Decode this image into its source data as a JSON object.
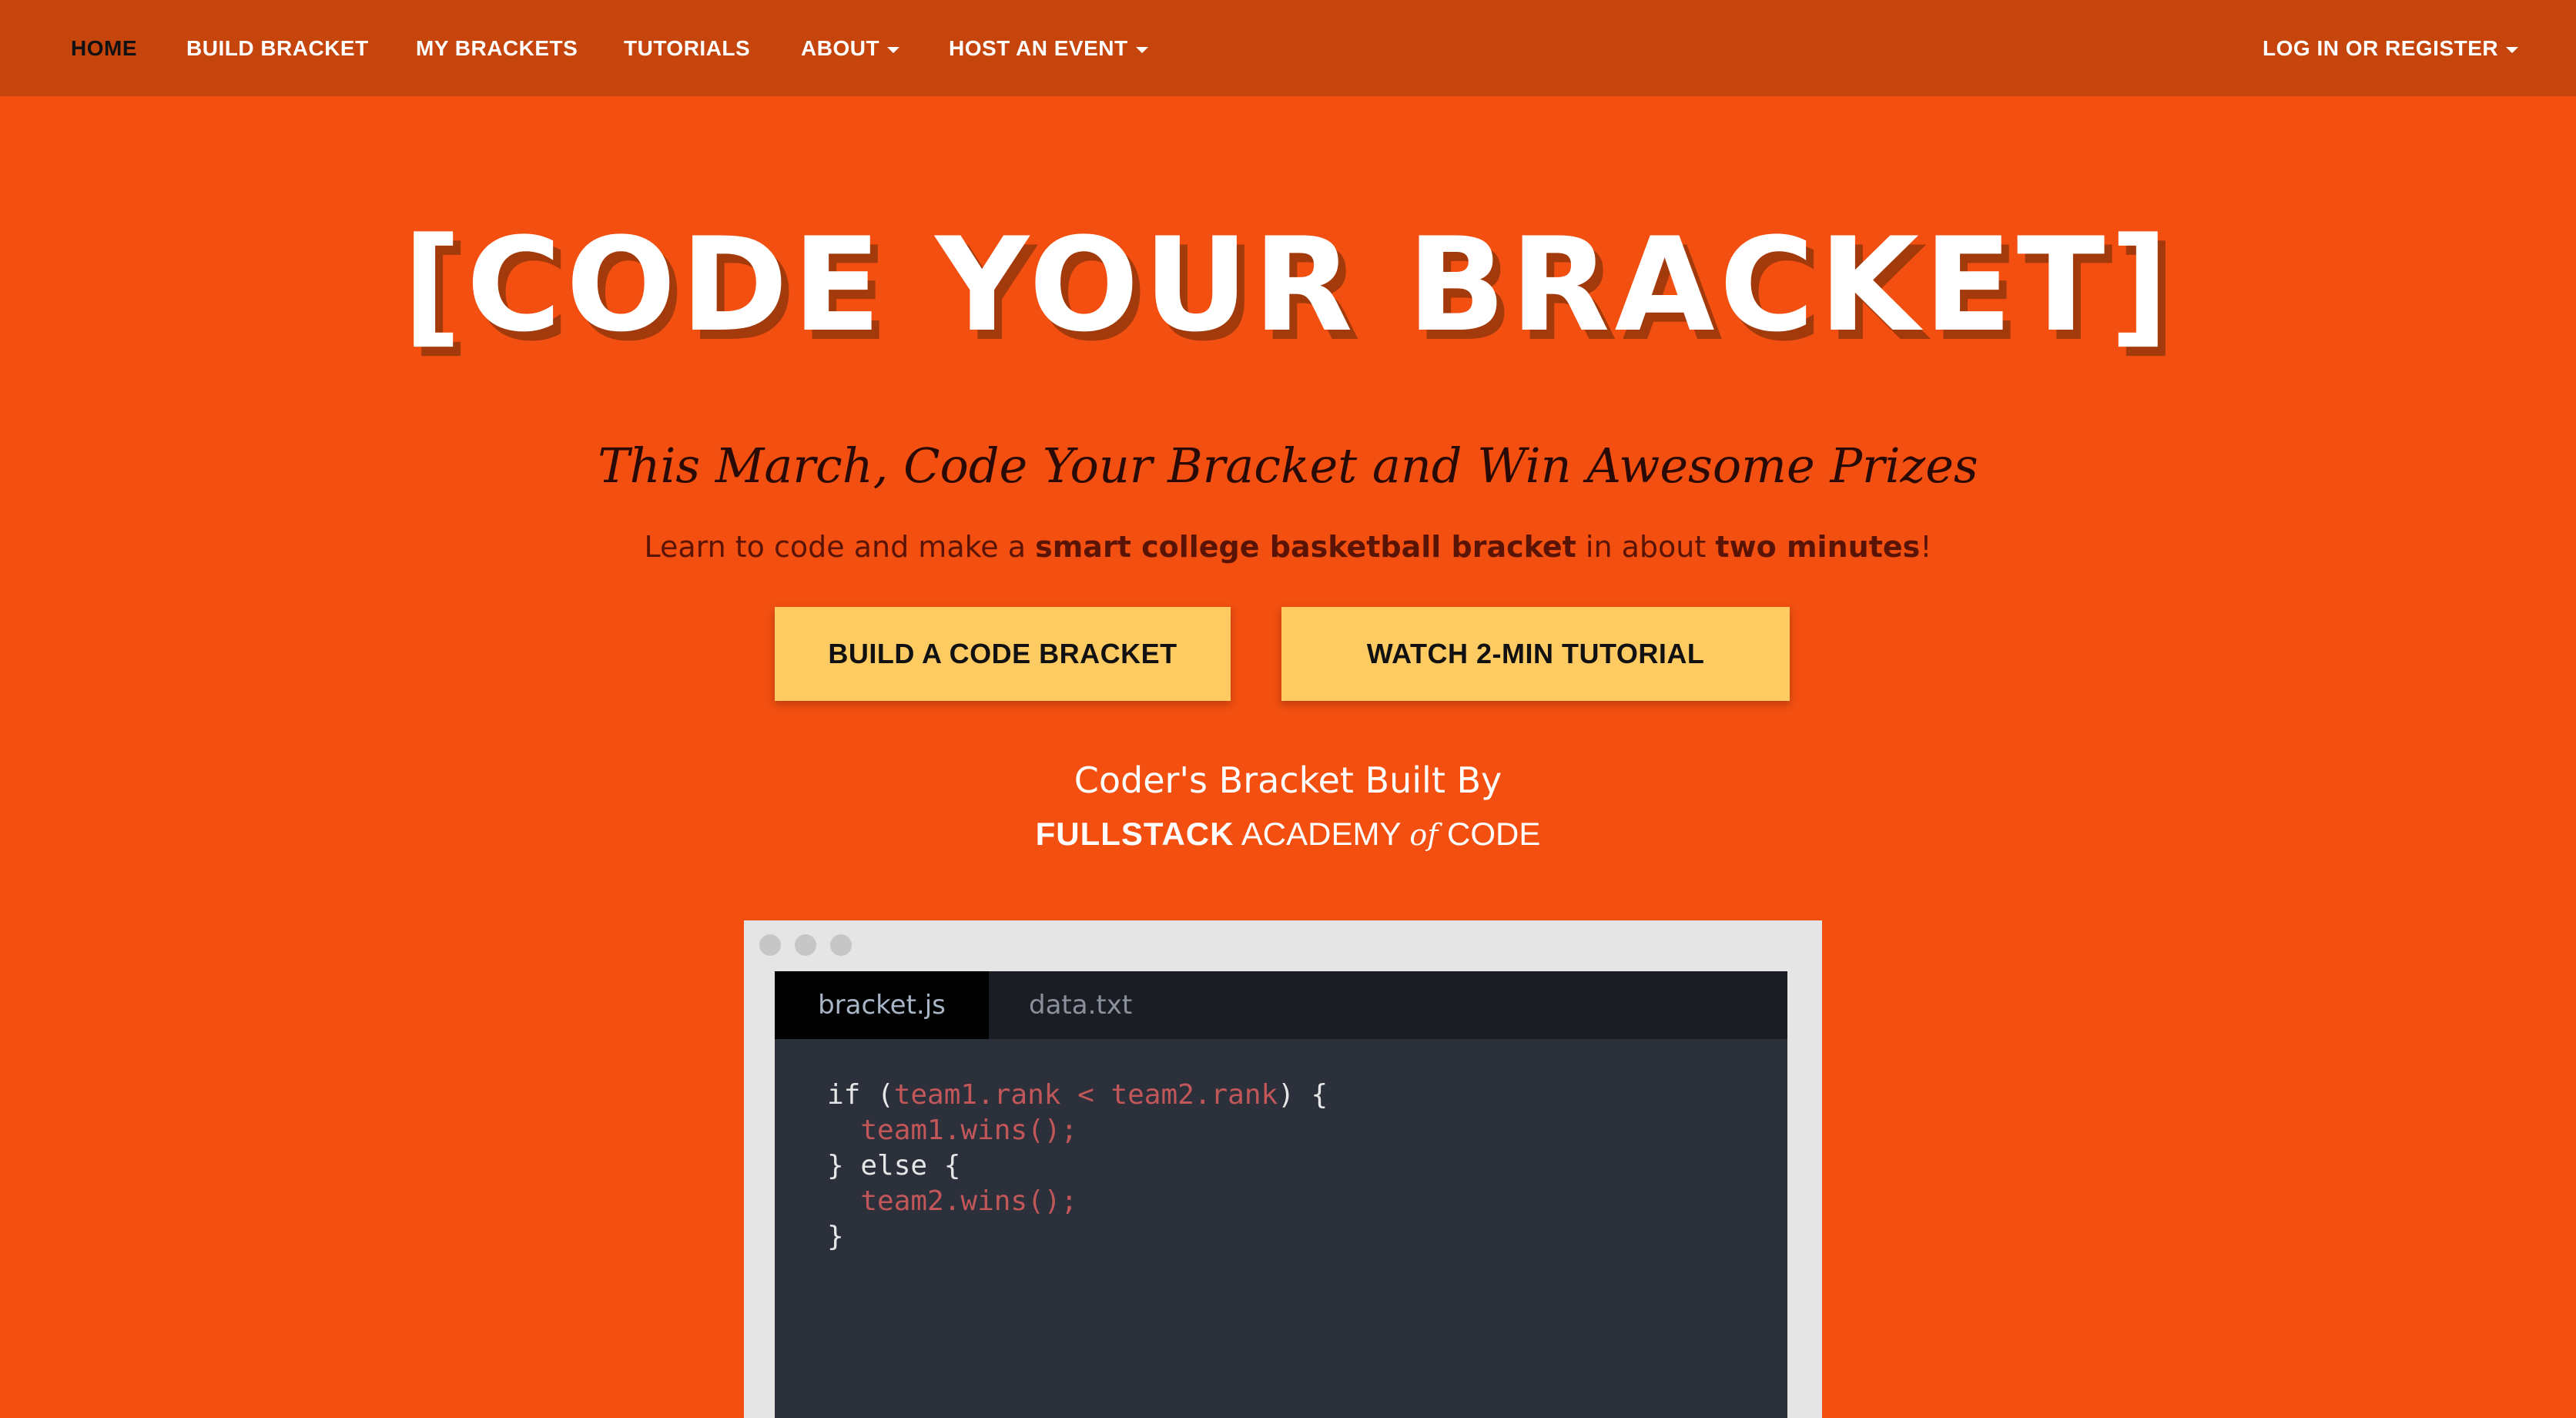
{
  "nav": {
    "items": [
      {
        "label": "HOME",
        "active": true
      },
      {
        "label": "BUILD BRACKET"
      },
      {
        "label": "MY BRACKETS"
      },
      {
        "label": "TUTORIALS"
      },
      {
        "label": "ABOUT",
        "dropdown": true
      },
      {
        "label": "HOST AN EVENT",
        "dropdown": true
      }
    ],
    "login_label": "LOG IN OR REGISTER"
  },
  "hero": {
    "title": "[CODE YOUR BRACKET]",
    "tagline": "This March, Code Your Bracket and Win Awesome Prizes",
    "subline": {
      "part1": "Learn to code and make a ",
      "bold1": "smart college basketball bracket",
      "part2": " in about ",
      "bold2": "two minutes",
      "part3": "!"
    },
    "buttons": {
      "build": "BUILD A CODE BRACKET",
      "tutorial": "WATCH 2-MIN TUTORIAL"
    },
    "built_by": "Coder's Bracket Built By",
    "sponsor": {
      "bold": "FULLSTACK",
      "academy": "ACADEMY",
      "of": "of",
      "code": "CODE"
    }
  },
  "editor": {
    "tabs": [
      "bracket.js",
      "data.txt"
    ],
    "active_tab": "bracket.js",
    "code": {
      "l1_a": "if (",
      "l1_b": "team1.rank < team2.rank",
      "l1_c": ") {",
      "l2": "team1.wins();",
      "l3": "} else {",
      "l4": "team2.wins();",
      "l5": "}"
    }
  },
  "colors": {
    "background": "#f24f10",
    "navbar": "#c5450c",
    "button": "#fecb63",
    "editor_bg": "#2b303b",
    "code_highlight": "#c2575a"
  }
}
